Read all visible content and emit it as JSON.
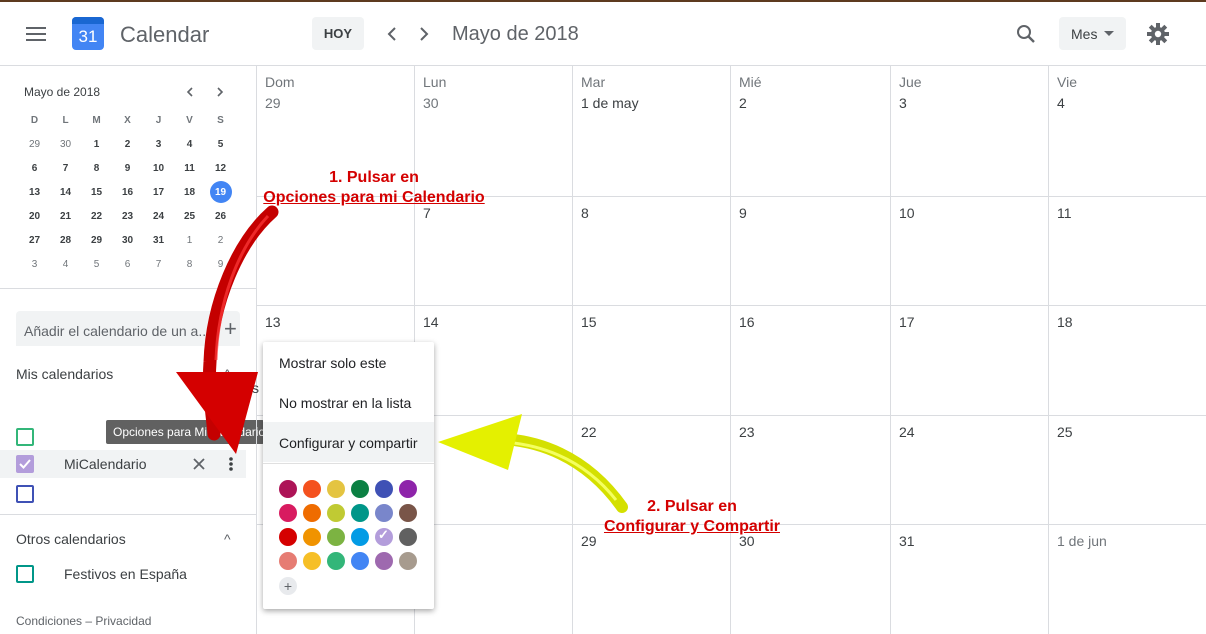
{
  "app": {
    "title": "Calendar",
    "logo_day": "31"
  },
  "toolbar": {
    "today": "HOY",
    "period": "Mayo de 2018",
    "view": "Mes",
    "icons": [
      "menu-icon",
      "chevron-left-icon",
      "chevron-right-icon",
      "search-icon",
      "gear-icon"
    ]
  },
  "mini_calendar": {
    "title": "Mayo de 2018",
    "weekday_headers": [
      "D",
      "L",
      "M",
      "X",
      "J",
      "V",
      "S"
    ],
    "weeks": [
      [
        "29",
        "30",
        "1",
        "2",
        "3",
        "4",
        "5"
      ],
      [
        "6",
        "7",
        "8",
        "9",
        "10",
        "11",
        "12"
      ],
      [
        "13",
        "14",
        "15",
        "16",
        "17",
        "18",
        "19"
      ],
      [
        "20",
        "21",
        "22",
        "23",
        "24",
        "25",
        "26"
      ],
      [
        "27",
        "28",
        "29",
        "30",
        "31",
        "1",
        "2"
      ],
      [
        "3",
        "4",
        "5",
        "6",
        "7",
        "8",
        "9"
      ]
    ],
    "selected": "19"
  },
  "sidebar": {
    "add_calendar_placeholder": "Añadir el calendario de un a...",
    "my_calendars_label": "Mis calendarios",
    "my_calendar_name": "MiCalendario",
    "tooltip": "Opciones para MiCalendario",
    "other_calendars_label": "Otros calendarios",
    "holidays_name": "Festivos en España",
    "footer": "Condiciones – Privacidad",
    "colors": {
      "green": "#33b679",
      "purple": "#b39ddb",
      "navy": "#3f51b5"
    }
  },
  "grid": {
    "weekdays": [
      "Dom",
      "Lun",
      "Mar",
      "Mié",
      "Jue",
      "Vie"
    ],
    "rows": [
      [
        "29",
        "30",
        "1 de may",
        "2",
        "3",
        "4"
      ],
      [
        "",
        "7",
        "8",
        "9",
        "10",
        "11"
      ],
      [
        "13",
        "14",
        "15",
        "16",
        "17",
        "18"
      ],
      [
        "",
        "",
        "22",
        "23",
        "24",
        "25"
      ],
      [
        "",
        "",
        "29",
        "30",
        "31",
        "1 de jun"
      ]
    ],
    "extra_s": "s"
  },
  "context_menu": {
    "items": [
      "Mostrar solo este",
      "No mostrar en la lista",
      "Configurar y compartir"
    ],
    "palette": [
      [
        "#ad1457",
        "#f4511e",
        "#e4c441",
        "#0b8043",
        "#3f51b5",
        "#8e24aa"
      ],
      [
        "#d81b60",
        "#ef6c00",
        "#c0ca33",
        "#009688",
        "#7986cb",
        "#795548"
      ],
      [
        "#d50000",
        "#f09300",
        "#7cb342",
        "#039be5",
        "#b39ddb",
        "#616161"
      ],
      [
        "#e67c73",
        "#f6bf26",
        "#33b679",
        "#4285f4",
        "#9e69af",
        "#a79b8e"
      ]
    ],
    "checked_color": "#b39ddb",
    "add_color": "+"
  },
  "annotations": {
    "step1_line1": "1. Pulsar en",
    "step1_line2": "Opciones para mi Calendario",
    "step2_line1": "2. Pulsar en",
    "step2_line2": "Configurar y Compartir",
    "red": "#d40000",
    "yellow": "#e4f000"
  }
}
